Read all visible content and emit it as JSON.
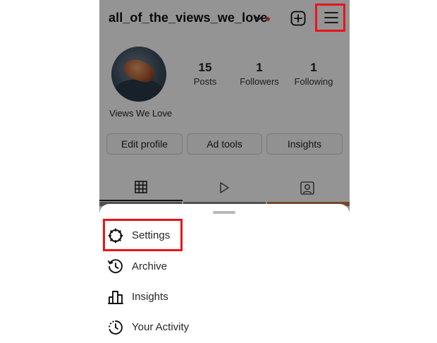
{
  "profile": {
    "username": "all_of_the_views_we_love",
    "display_name": "Views We Love",
    "stats": [
      {
        "value": "15",
        "label": "Posts"
      },
      {
        "value": "1",
        "label": "Followers"
      },
      {
        "value": "1",
        "label": "Following"
      }
    ],
    "buttons": {
      "edit_profile": "Edit profile",
      "ad_tools": "Ad tools",
      "insights": "Insights"
    }
  },
  "menu": {
    "items": [
      {
        "label": "Settings",
        "icon": "settings-icon"
      },
      {
        "label": "Archive",
        "icon": "archive-icon"
      },
      {
        "label": "Insights",
        "icon": "insights-icon"
      },
      {
        "label": "Your Activity",
        "icon": "activity-icon"
      }
    ]
  },
  "colors": {
    "highlight": "#e8141b",
    "notification_dot": "#ed4956"
  }
}
